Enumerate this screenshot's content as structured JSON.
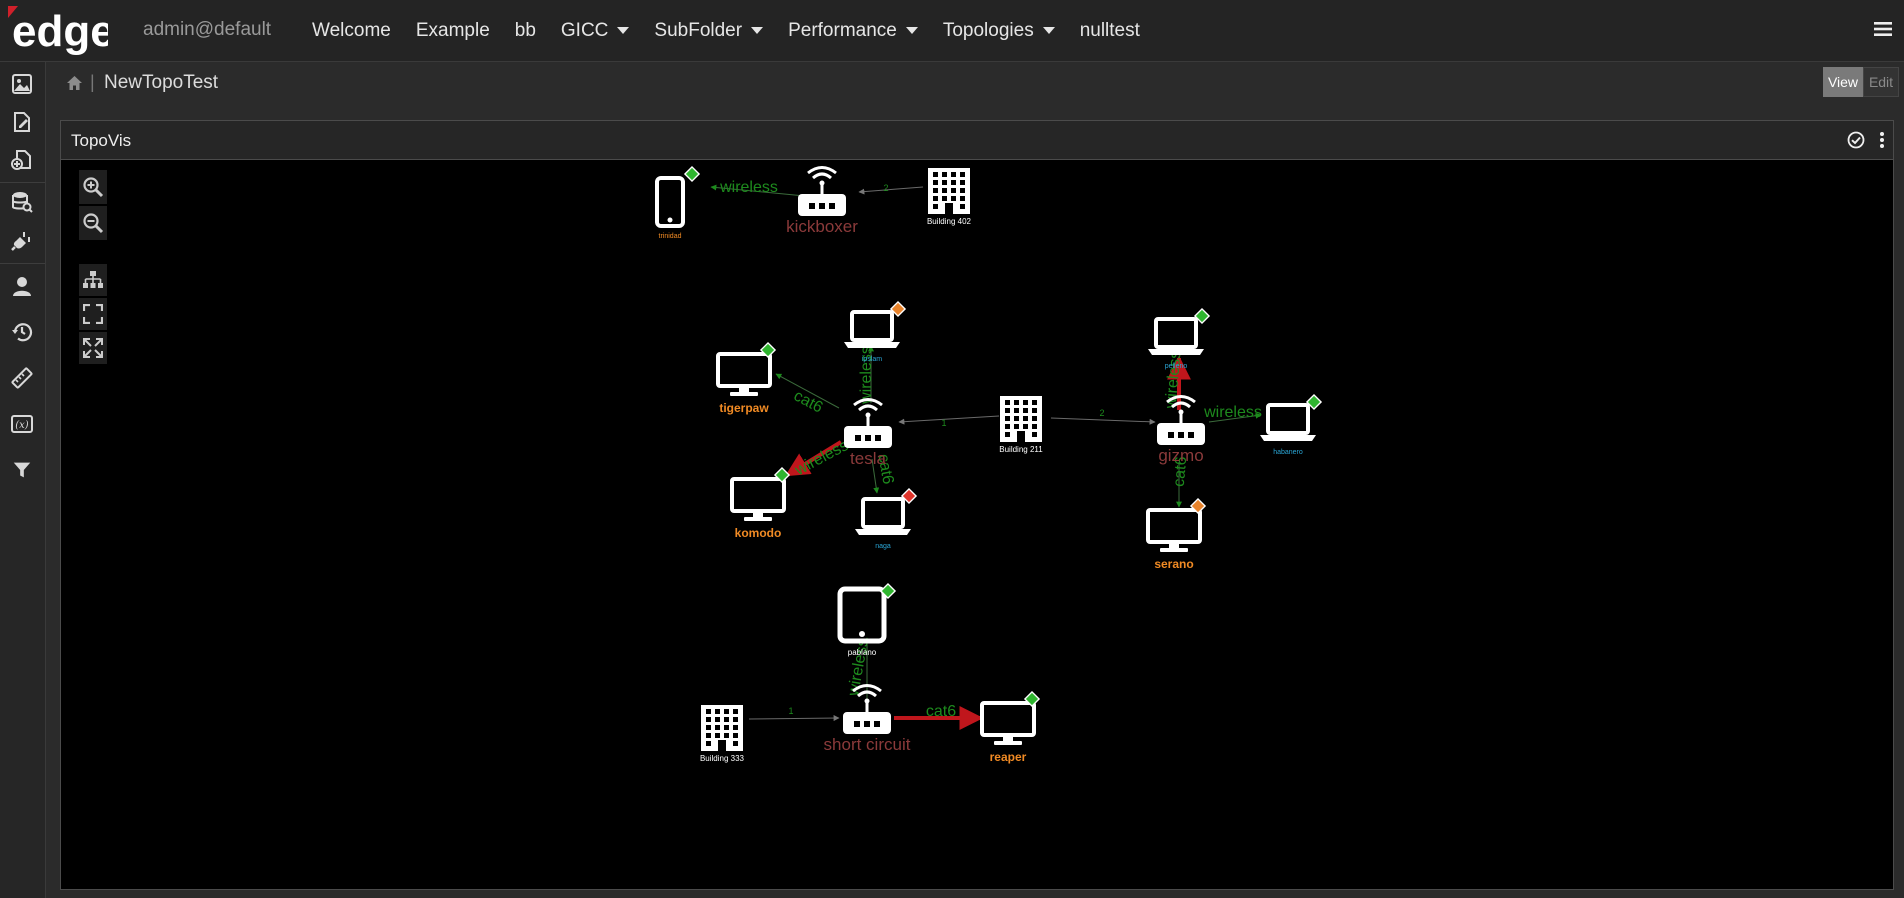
{
  "app": {
    "logo_text": "edge",
    "user": "admin@default",
    "menu": [
      {
        "label": "Welcome",
        "dropdown": false
      },
      {
        "label": "Example",
        "dropdown": false
      },
      {
        "label": "bb",
        "dropdown": false
      },
      {
        "label": "GICC",
        "dropdown": true
      },
      {
        "label": "SubFolder",
        "dropdown": true
      },
      {
        "label": "Performance",
        "dropdown": true
      },
      {
        "label": "Topologies",
        "dropdown": true
      },
      {
        "label": "nulltest",
        "dropdown": false
      }
    ]
  },
  "sidebar": {
    "icons": [
      "image-icon",
      "edit-document-icon",
      "add-document-icon",
      "database-search-icon",
      "plug-icon",
      "user-icon",
      "history-icon",
      "ruler-icon",
      "function-icon",
      "filter-icon"
    ]
  },
  "breadcrumb": {
    "title": "NewTopoTest",
    "separator": "|"
  },
  "mode": {
    "view_label": "View",
    "edit_label": "Edit",
    "active": "View"
  },
  "panel": {
    "title": "TopoVis"
  },
  "topology": {
    "colors": {
      "status_green": "#2fb52f",
      "status_orange": "#e8832b",
      "status_red": "#e0342b",
      "router_label": "#8b3a3a",
      "link_label": "#1d8a1d",
      "alert_link": "#c0161c",
      "device_label_orange": "#f08a24",
      "device_label_blue": "#2aa6d6"
    },
    "nodes": [
      {
        "id": "trinidad",
        "label": "trinidad",
        "type": "phone",
        "status": "green",
        "label_style": "orange-small"
      },
      {
        "id": "kickboxer",
        "label": "kickboxer",
        "type": "router",
        "status": "",
        "label_style": "router"
      },
      {
        "id": "building402",
        "label": "Building 402",
        "type": "building",
        "status": "",
        "label_style": "white-small"
      },
      {
        "id": "tigerpaw",
        "label": "tigerpaw",
        "type": "desktop",
        "status": "green",
        "label_style": "orange"
      },
      {
        "id": "ipslam",
        "label": "ipslam",
        "type": "laptop",
        "status": "orange",
        "label_style": "blue-small"
      },
      {
        "id": "tesla",
        "label": "tesla",
        "type": "router",
        "status": "",
        "label_style": "router"
      },
      {
        "id": "building211",
        "label": "Building 211",
        "type": "building",
        "status": "",
        "label_style": "white-small"
      },
      {
        "id": "komodo",
        "label": "komodo",
        "type": "desktop",
        "status": "green",
        "label_style": "orange"
      },
      {
        "id": "naga",
        "label": "naga",
        "type": "laptop",
        "status": "red",
        "label_style": "blue-small"
      },
      {
        "id": "pelleno",
        "label": "pelleno",
        "type": "laptop",
        "status": "green",
        "label_style": "blue-small"
      },
      {
        "id": "gizmo",
        "label": "gizmo",
        "type": "router",
        "status": "",
        "label_style": "router"
      },
      {
        "id": "habanero",
        "label": "habanero",
        "type": "laptop",
        "status": "green",
        "label_style": "blue-small"
      },
      {
        "id": "serano",
        "label": "serano",
        "type": "desktop",
        "status": "orange",
        "label_style": "orange"
      },
      {
        "id": "pablano",
        "label": "pablano",
        "type": "tablet",
        "status": "green",
        "label_style": "white-small"
      },
      {
        "id": "building333",
        "label": "Building 333",
        "type": "building",
        "status": "",
        "label_style": "white-small"
      },
      {
        "id": "shortcircuit",
        "label": "short circuit",
        "type": "router",
        "status": "",
        "label_style": "router"
      },
      {
        "id": "reaper",
        "label": "reaper",
        "type": "desktop",
        "status": "green",
        "label_style": "orange"
      }
    ],
    "links": [
      {
        "from": "kickboxer",
        "to": "trinidad",
        "label": "wireless",
        "kind": "normal"
      },
      {
        "from": "building402",
        "to": "kickboxer",
        "label": "2",
        "kind": "thin"
      },
      {
        "from": "tesla",
        "to": "tigerpaw",
        "label": "cat6",
        "kind": "normal"
      },
      {
        "from": "tesla",
        "to": "ipslam",
        "label": "wireless",
        "kind": "normal"
      },
      {
        "from": "building211",
        "to": "tesla",
        "label": "1",
        "kind": "thin"
      },
      {
        "from": "tesla",
        "to": "komodo",
        "label": "wireless",
        "kind": "alert"
      },
      {
        "from": "tesla",
        "to": "naga",
        "label": "cat6",
        "kind": "normal"
      },
      {
        "from": "building211",
        "to": "gizmo",
        "label": "2",
        "kind": "thin"
      },
      {
        "from": "gizmo",
        "to": "pelleno",
        "label": "wireless",
        "kind": "alert"
      },
      {
        "from": "gizmo",
        "to": "habanero",
        "label": "wireless",
        "kind": "normal"
      },
      {
        "from": "gizmo",
        "to": "serano",
        "label": "cat6",
        "kind": "normal"
      },
      {
        "from": "shortcircuit",
        "to": "pablano",
        "label": "wireless",
        "kind": "normal"
      },
      {
        "from": "building333",
        "to": "shortcircuit",
        "label": "1",
        "kind": "thin"
      },
      {
        "from": "shortcircuit",
        "to": "reaper",
        "label": "cat6",
        "kind": "alert"
      }
    ]
  }
}
